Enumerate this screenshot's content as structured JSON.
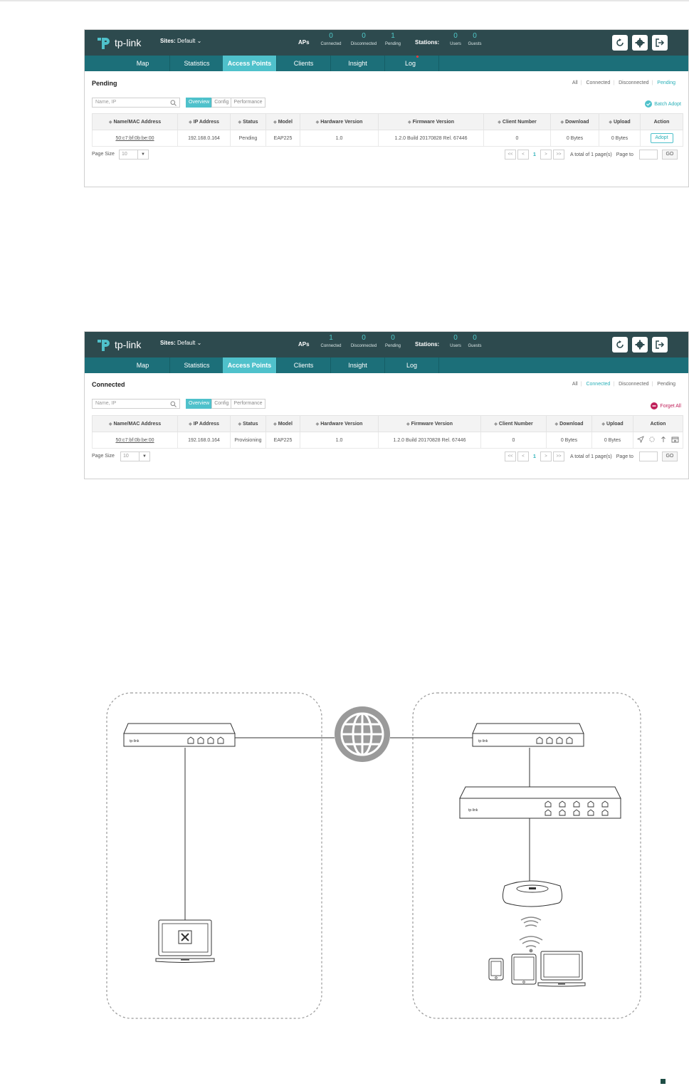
{
  "header": {
    "logo_text": "tp-link",
    "sites_label": "Sites:",
    "sites_value": "Default",
    "aps_label": "APs",
    "stations_label": "Stations:"
  },
  "nav": {
    "items": [
      "Map",
      "Statistics",
      "Access Points",
      "Clients",
      "Insight",
      "Log"
    ]
  },
  "filters": [
    "All",
    "Connected",
    "Disconnected",
    "Pending"
  ],
  "search_placeholder": "Name, IP",
  "view_tabs": [
    "Overview",
    "Config",
    "Performance"
  ],
  "columns": [
    "Name/MAC Address",
    "IP Address",
    "Status",
    "Model",
    "Hardware Version",
    "Firmware Version",
    "Client Number",
    "Download",
    "Upload",
    "Action"
  ],
  "pagination": {
    "page_size_label": "Page Size",
    "page_size_value": "10",
    "first": "<<",
    "prev": "<",
    "current": "1",
    "next": ">",
    "last": ">>",
    "total_text": "A total of 1 page(s)",
    "page_to_label": "Page to",
    "go_label": "GO"
  },
  "panel_pending": {
    "title": "Pending",
    "active_filter": "Pending",
    "top_action": "Batch Adopt",
    "aps": [
      {
        "num": "0",
        "label": "Connected"
      },
      {
        "num": "0",
        "label": "Disconnected"
      },
      {
        "num": "1",
        "label": "Pending"
      }
    ],
    "stations": [
      {
        "num": "0",
        "label": "Users"
      },
      {
        "num": "0",
        "label": "Guests"
      }
    ],
    "row": {
      "mac": "50:c7:bf:0b:be:00",
      "ip": "192.168.0.164",
      "status": "Pending",
      "model": "EAP225",
      "hw": "1.0",
      "fw": "1.2.0 Build 20170828 Rel. 67446",
      "clients": "0",
      "download": "0 Bytes",
      "upload": "0 Bytes",
      "action": "Adopt"
    }
  },
  "panel_connected": {
    "title": "Connected",
    "active_filter": "Connected",
    "top_action": "Forget All",
    "aps": [
      {
        "num": "1",
        "label": "Connected"
      },
      {
        "num": "0",
        "label": "Disconnected"
      },
      {
        "num": "0",
        "label": "Pending"
      }
    ],
    "stations": [
      {
        "num": "0",
        "label": "Users"
      },
      {
        "num": "0",
        "label": "Guests"
      }
    ],
    "row": {
      "mac": "50:c7:bf:0b:be:00",
      "ip": "192.168.0.164",
      "status": "Provisioning",
      "model": "EAP225",
      "hw": "1.0",
      "fw": "1.2.0 Build 20170828 Rel. 67446",
      "clients": "0",
      "download": "0 Bytes",
      "upload": "0 Bytes"
    }
  },
  "diagram_labels": {
    "device_brand": "tp-link"
  },
  "colors": {
    "header": "#2d4a4e",
    "nav": "#1c6f79",
    "accent": "#4fc1cb",
    "forget": "#c0205a"
  }
}
